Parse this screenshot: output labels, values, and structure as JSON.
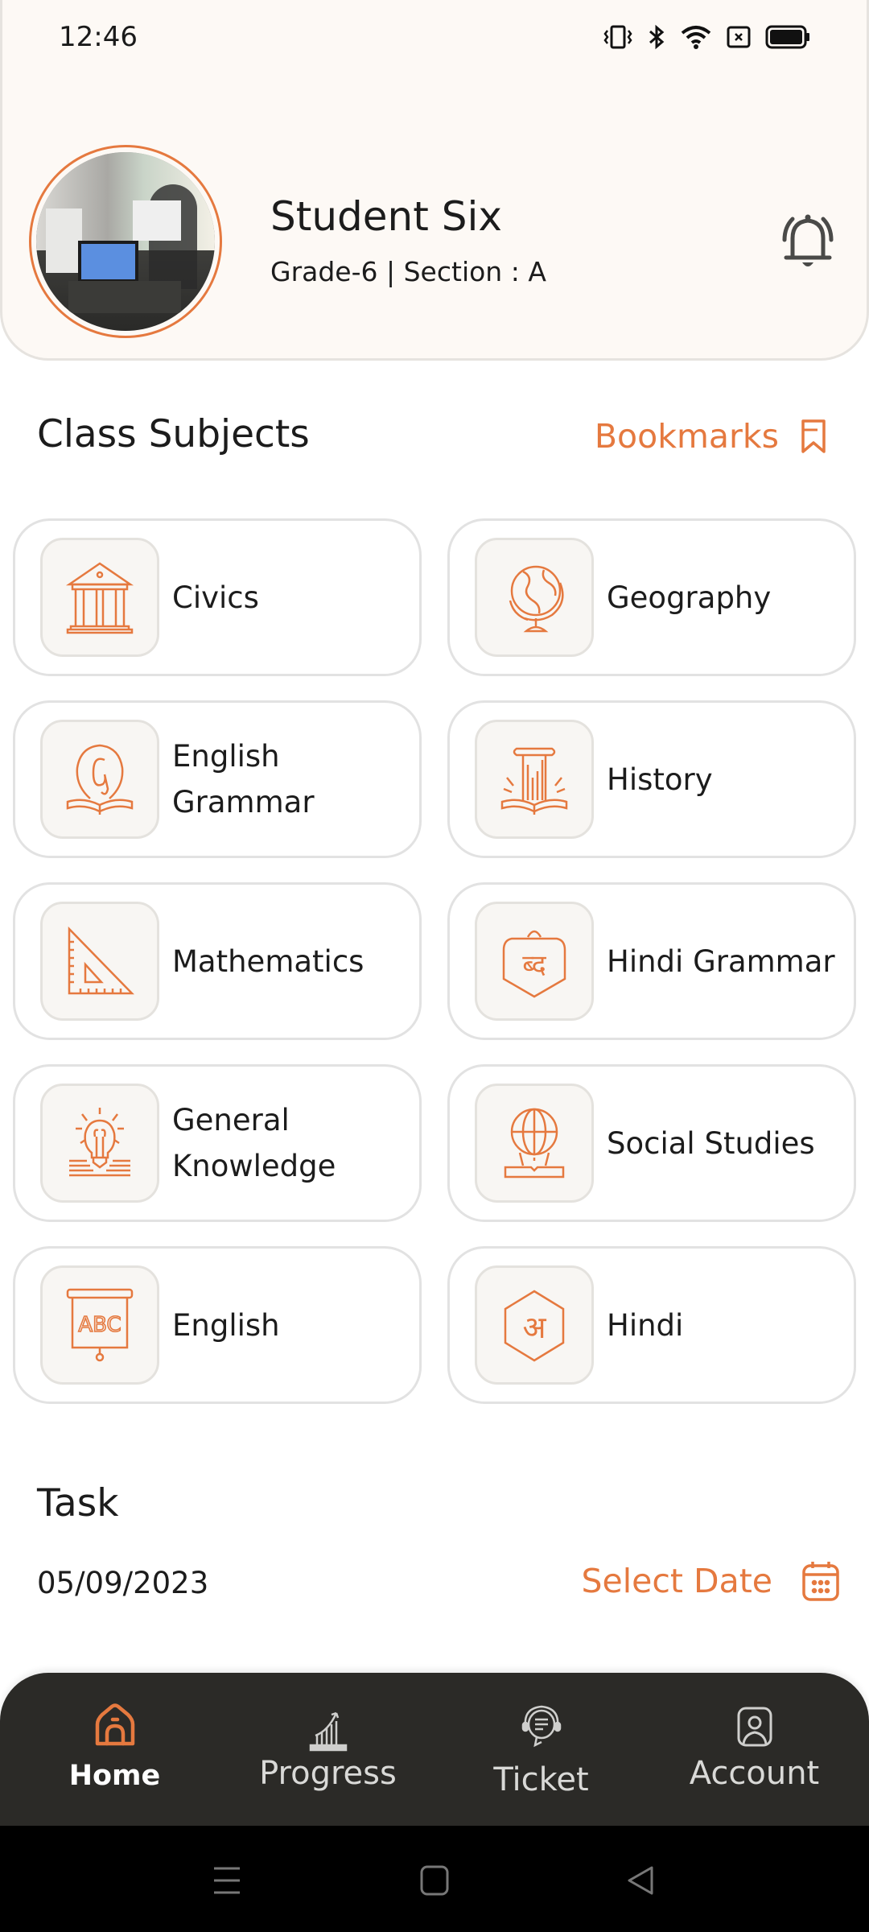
{
  "status_bar": {
    "time": "12:46",
    "icons": [
      "vibrate-icon",
      "bluetooth-icon",
      "wifi-icon",
      "sim-none-icon",
      "battery-icon"
    ]
  },
  "profile": {
    "name": "Student Six",
    "subtitle": "Grade-6 | Section : A",
    "avatar_icon": "avatar-photo",
    "notification_icon": "bell-icon"
  },
  "subjects_section": {
    "title": "Class Subjects",
    "bookmarks_label": "Bookmarks",
    "bookmarks_icon": "bookmark-icon"
  },
  "subjects": [
    {
      "label": "Civics",
      "icon": "building-columns-icon"
    },
    {
      "label": "Geography",
      "icon": "globe-stand-icon"
    },
    {
      "label": "English\nGrammar",
      "icon": "letter-g-book-icon"
    },
    {
      "label": "History",
      "icon": "pillar-book-icon"
    },
    {
      "label": "Mathematics",
      "icon": "set-square-icon"
    },
    {
      "label": "Hindi Grammar",
      "icon": "hindi-letter-shield-icon"
    },
    {
      "label": "General\nKnowledge",
      "icon": "lightbulb-book-icon"
    },
    {
      "label": "Social Studies",
      "icon": "globe-book-icon"
    },
    {
      "label": "English",
      "icon": "abc-board-icon"
    },
    {
      "label": "Hindi",
      "icon": "hindi-letter-hexagon-icon"
    }
  ],
  "task": {
    "title": "Task",
    "date": "05/09/2023",
    "select_date_label": "Select Date",
    "calendar_icon": "calendar-icon"
  },
  "bottom_nav": {
    "active": "Home",
    "items": [
      {
        "label": "Home",
        "icon": "home-icon"
      },
      {
        "label": "Progress",
        "icon": "chart-growth-icon"
      },
      {
        "label": "Ticket",
        "icon": "support-chat-icon"
      },
      {
        "label": "Account",
        "icon": "user-profile-icon"
      }
    ]
  },
  "colors": {
    "accent": "#e5793f",
    "header_bg": "#fdf9f5",
    "nav_bg": "#2b2a27",
    "text": "#1c1c1c"
  }
}
